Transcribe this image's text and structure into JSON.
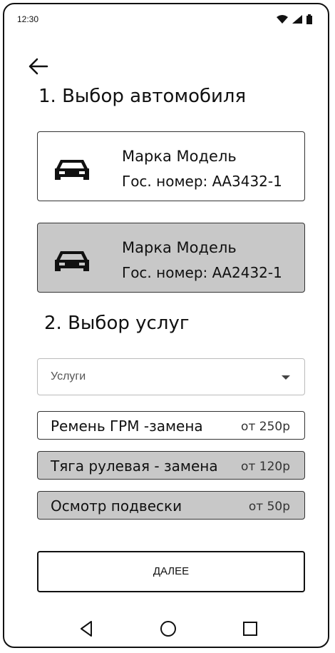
{
  "status": {
    "time": "12:30",
    "icons": [
      "wifi-icon",
      "signal-icon",
      "battery-icon"
    ]
  },
  "page": {
    "step1_title": "1. Выбор автомобиля",
    "step2_title": "2. Выбор услуг"
  },
  "cars": [
    {
      "model": "Марка Модель",
      "plate": "Гос. номер: АА3432-1",
      "selected": false,
      "icon": "car-icon"
    },
    {
      "model": "Марка Модель",
      "plate": "Гос. номер: АА2432-1",
      "selected": true,
      "icon": "car-icon"
    }
  ],
  "services_dropdown": {
    "placeholder": "Услуги"
  },
  "services": [
    {
      "name": "Ремень ГРМ -замена",
      "price": "от 250р",
      "selected": false
    },
    {
      "name": "Тяга рулевая - замена",
      "price": "от 120р",
      "selected": true
    },
    {
      "name": "Осмотр подвески",
      "price": "от 50р",
      "selected": true
    }
  ],
  "actions": {
    "next_label": "ДАЛЕЕ"
  },
  "colors": {
    "selected_bg": "#c8c8c8",
    "border": "#333333",
    "text": "#111111"
  }
}
